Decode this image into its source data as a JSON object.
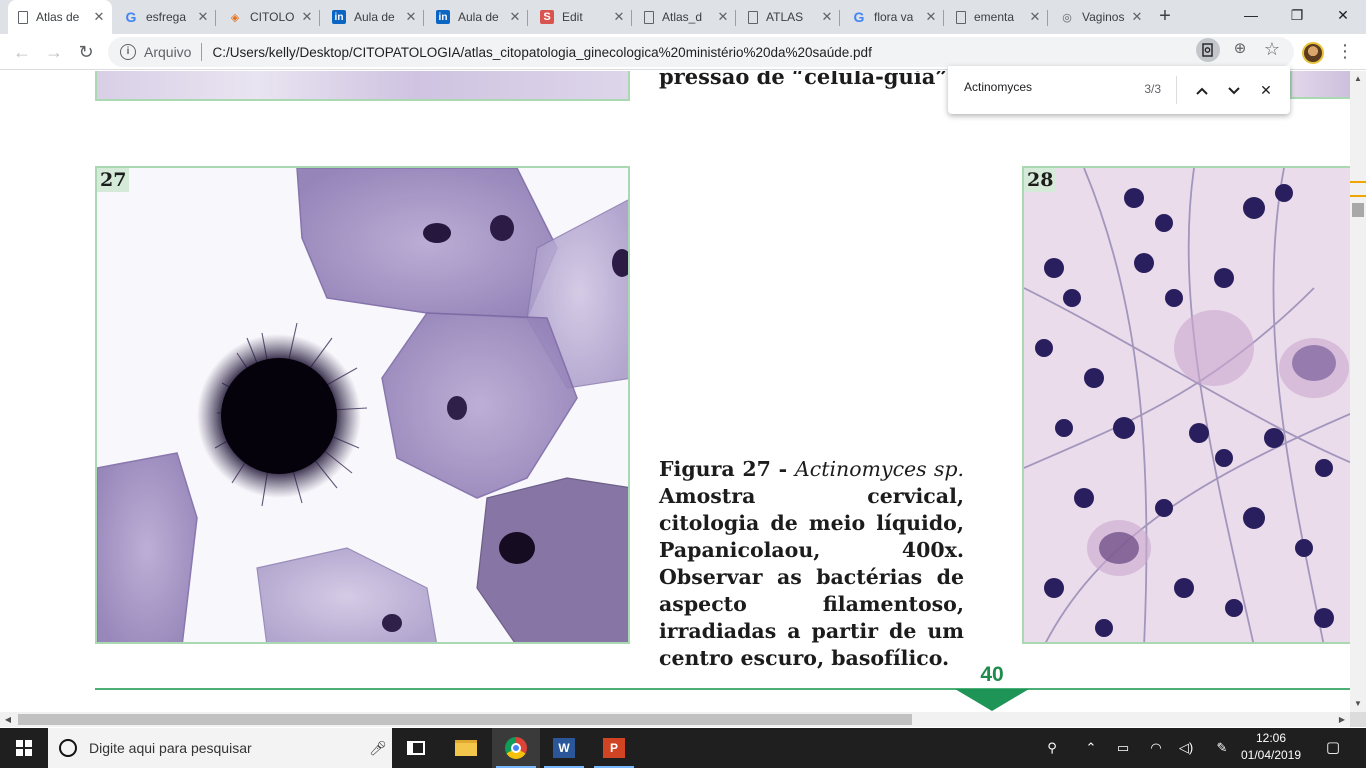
{
  "browser": {
    "tabs": [
      {
        "label": "Atlas de",
        "icon": "document-icon",
        "active": true
      },
      {
        "label": "esfrega",
        "icon": "google-icon"
      },
      {
        "label": "CITOLO",
        "icon": "graduation-cap-icon"
      },
      {
        "label": "Aula de",
        "icon": "linkedin-icon"
      },
      {
        "label": "Aula de",
        "icon": "linkedin-icon"
      },
      {
        "label": "Edit",
        "icon": "s-icon"
      },
      {
        "label": "Atlas_d",
        "icon": "document-icon"
      },
      {
        "label": "ATLAS",
        "icon": "document-icon"
      },
      {
        "label": "flora va",
        "icon": "google-icon"
      },
      {
        "label": "ementa",
        "icon": "document-icon"
      },
      {
        "label": "Vaginos",
        "icon": "drop-icon"
      }
    ],
    "new_tab": "+",
    "window": {
      "minimize": "—",
      "maximize": "❐",
      "close": "✕"
    },
    "toolbar": {
      "back": "←",
      "forward": "→",
      "reload": "↻",
      "info_symbol": "i",
      "scheme_label": "Arquivo",
      "url": "C:/Users/kelly/Desktop/CITOPATOLOGIA/atlas_citopatologia_ginecologica%20ministério%20da%20saúde.pdf",
      "zoom_symbol": "⊕",
      "star_symbol": "☆",
      "menu_symbol": "⋮"
    },
    "find": {
      "query": "Actinomyces",
      "count": "3/3",
      "prev": "⌃",
      "next": "⌄",
      "close": "✕"
    }
  },
  "pdf": {
    "top_caption_line": "pressão de “célula-guia”.",
    "figure_27_number": "27",
    "figure_28_number": "28",
    "caption": {
      "fig_label": "Figura 27 - ",
      "genus": "Actinomyces",
      "species": " sp.",
      "body": " Amostra cervical, citologia de meio líquido, Papanicolaou, 400x. Observar as bactérias de aspecto filamentoso, irradiadas a partir de um centro escuro, basofílico."
    },
    "page_number": "40"
  },
  "taskbar": {
    "search_placeholder": "Digite aqui para pesquisar",
    "word_letter": "W",
    "ppt_letter": "P",
    "time": "12:06",
    "date": "01/04/2019"
  },
  "colors": {
    "accent_green": "#1e9556",
    "frame_green": "#a9d8b3",
    "tabstrip": "#dee1e6"
  }
}
